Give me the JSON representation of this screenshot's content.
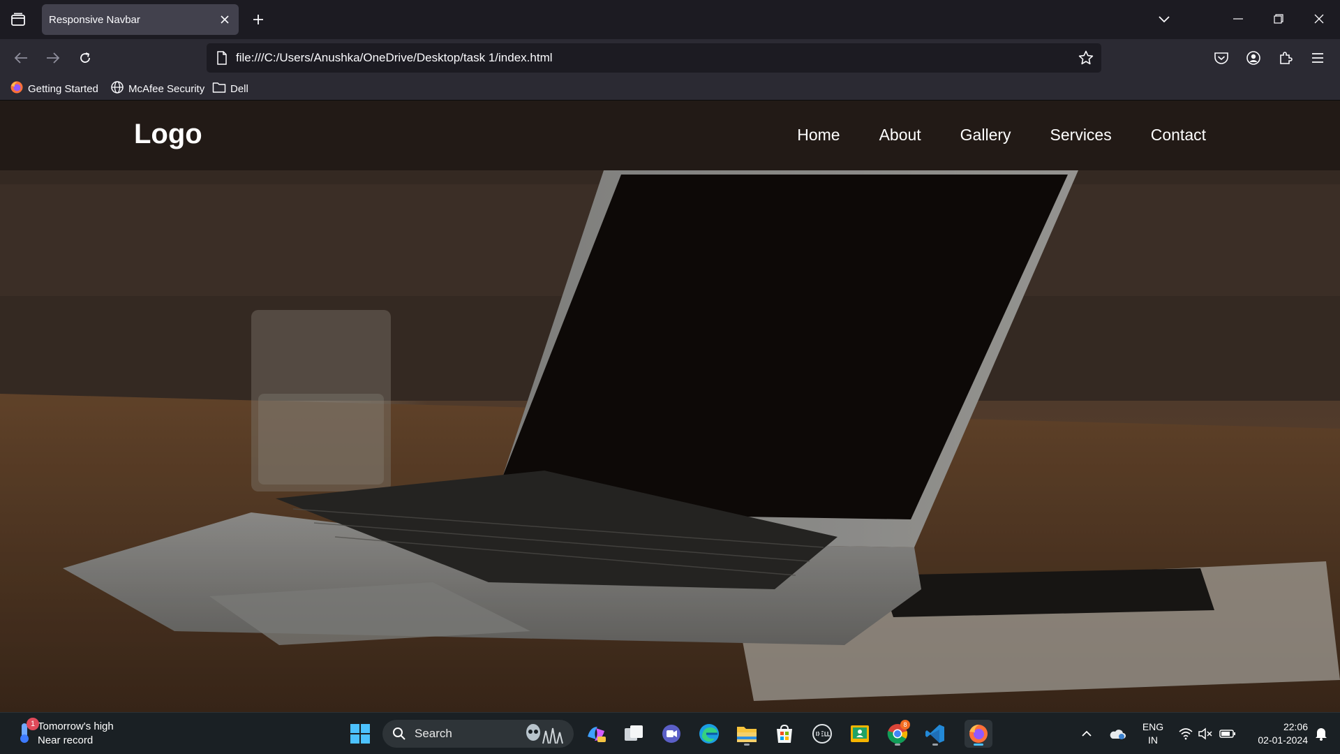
{
  "browser": {
    "tab_title": "Responsive Navbar",
    "url": "file:///C:/Users/Anushka/OneDrive/Desktop/task 1/index.html",
    "bookmarks": [
      {
        "label": "Getting Started",
        "icon": "firefox-icon"
      },
      {
        "label": "McAfee Security",
        "icon": "globe-icon"
      },
      {
        "label": "Dell",
        "icon": "folder-icon"
      }
    ]
  },
  "site": {
    "logo": "Logo",
    "nav": [
      "Home",
      "About",
      "Gallery",
      "Services",
      "Contact"
    ],
    "hero_image": "laptop on wooden desk with glass and notebook"
  },
  "taskbar": {
    "weather_line1": "Tomorrow's high",
    "weather_line2": "Near record",
    "weather_badge": "1",
    "search_label": "Search",
    "lang_line1": "ENG",
    "lang_line2": "IN",
    "time": "22:06",
    "date": "02-01-2024",
    "chrome_badge": "8"
  },
  "colors": {
    "chrome_dark": "#1c1b22",
    "chrome_toolbar": "#2b2a33",
    "tab_active": "#42414d",
    "taskbar": "#1a2024"
  }
}
